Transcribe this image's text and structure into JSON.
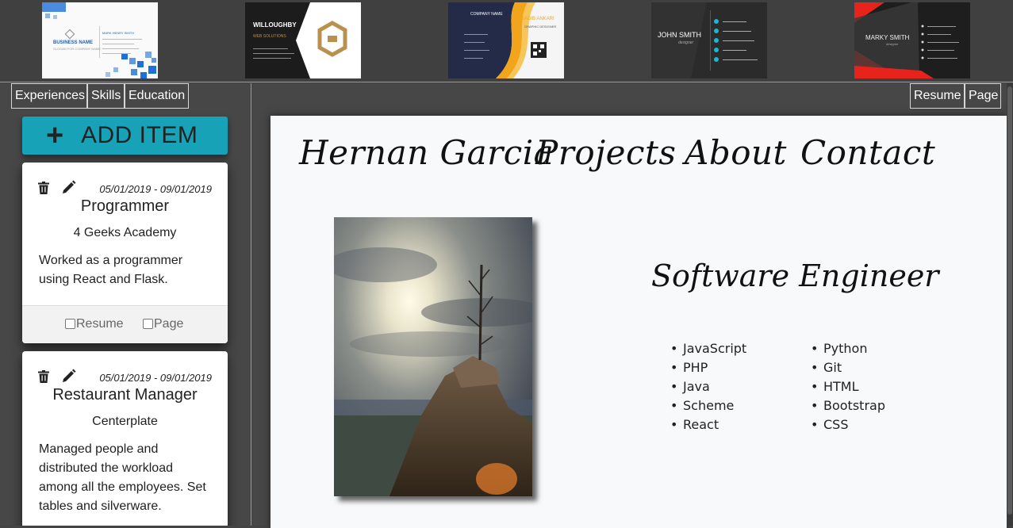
{
  "templates": [
    {
      "name": "BUSINESS NAME",
      "person": "MARK HENRY SMITH",
      "tagline": "SLOGAN FOR COMPANY NAME"
    },
    {
      "name": "WILLOUGHBY",
      "tagline": "WEB SOLUTIONS"
    },
    {
      "name": "COMPANY NAME",
      "person": "SADIB ANKARI",
      "tagline": "GRAPHIC DESIGNER"
    },
    {
      "name": "JOHN SMITH",
      "tagline": "designer"
    },
    {
      "name": "MARKY SMITH",
      "tagline": "designer"
    }
  ],
  "left_tabs": [
    "Experiences",
    "Skills",
    "Education"
  ],
  "right_tabs": [
    "Resume",
    "Page"
  ],
  "add_item_label": "ADD ITEM",
  "cards": [
    {
      "dates": "05/01/2019 - 09/01/2019",
      "title": "Programmer",
      "company": "4 Geeks Academy",
      "description": "Worked as a programmer using React and Flask.",
      "resume_label": "Resume",
      "page_label": "Page"
    },
    {
      "dates": "05/01/2019 - 09/01/2019",
      "title": "Restaurant Manager",
      "company": "Centerplate",
      "description": "Managed people and distributed the workload among all the employees. Set tables and silverware."
    }
  ],
  "page": {
    "nav": [
      "Hernan Garcia",
      "Projects",
      "About",
      "Contact"
    ],
    "role": "Software Engineer",
    "skills_col1": [
      "JavaScript",
      "PHP",
      "Java",
      "Scheme",
      "React"
    ],
    "skills_col2": [
      "Python",
      "Git",
      "HTML",
      "Bootstrap",
      "CSS"
    ]
  },
  "icons": [
    "plus-icon",
    "trash-icon",
    "pencil-icon"
  ],
  "colors": {
    "accent": "#17a2b8",
    "background": "#474747",
    "canvas": "#f8f9fa"
  }
}
